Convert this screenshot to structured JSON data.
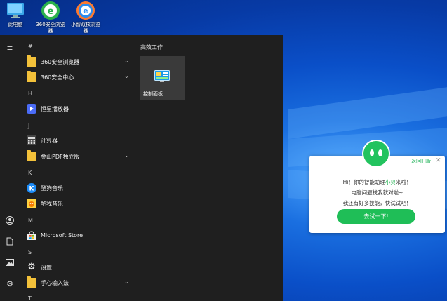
{
  "desktop": {
    "icons": [
      {
        "label": "此电脑",
        "icon": "computer-icon"
      },
      {
        "label": "360安全浏览器",
        "icon": "360-browser-icon"
      },
      {
        "label": "小智双核浏览器",
        "icon": "xiaozhi-browser-icon"
      }
    ]
  },
  "start_menu": {
    "rail": [
      "menu-icon",
      "user-icon",
      "document-icon",
      "pictures-icon",
      "settings-icon"
    ],
    "sections": [
      {
        "letter": "#",
        "apps": [
          {
            "label": "360安全浏览器",
            "icon": "folder-icon",
            "expandable": true
          },
          {
            "label": "360安全中心",
            "icon": "folder-icon",
            "expandable": true
          }
        ]
      },
      {
        "letter": "H",
        "apps": [
          {
            "label": "恒星播放器",
            "icon": "player-icon",
            "expandable": false
          }
        ]
      },
      {
        "letter": "J",
        "apps": [
          {
            "label": "计算器",
            "icon": "calculator-icon",
            "expandable": false
          },
          {
            "label": "金山PDF独立版",
            "icon": "folder-icon",
            "expandable": true
          }
        ]
      },
      {
        "letter": "K",
        "apps": [
          {
            "label": "酷狗音乐",
            "icon": "kugou-icon",
            "expandable": false
          },
          {
            "label": "酷我音乐",
            "icon": "kuwo-icon",
            "expandable": false
          }
        ]
      },
      {
        "letter": "M",
        "apps": [
          {
            "label": "Microsoft Store",
            "icon": "store-icon",
            "expandable": false
          }
        ]
      },
      {
        "letter": "S",
        "apps": [
          {
            "label": "设置",
            "icon": "gear-icon",
            "expandable": false
          },
          {
            "label": "手心输入法",
            "icon": "folder-icon",
            "expandable": true
          }
        ]
      },
      {
        "letter": "T",
        "apps": []
      }
    ],
    "tiles_header": "高效工作",
    "tile": {
      "label": "控制面板",
      "icon": "control-panel-icon"
    }
  },
  "popup": {
    "back_old": "返回旧版",
    "line1_pre": "Hi！你的智能助理",
    "line1_hl": "小贝",
    "line1_post": "来啦！",
    "line2": "电脑问题找我就对啦~",
    "line3": "我还有好多技能，快试试吧！",
    "button": "去试一下!",
    "colors": {
      "accent": "#1fbe57"
    }
  }
}
